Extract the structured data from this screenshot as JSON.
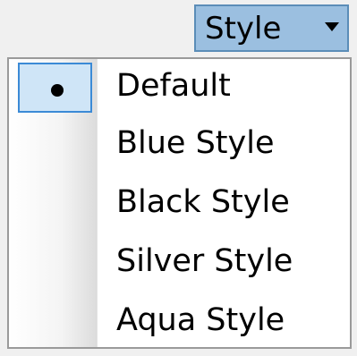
{
  "dropdown": {
    "label": "Style",
    "icon": "chevron-down-icon"
  },
  "menu": {
    "selected_index": 0,
    "selected_indicator_icon": "radio-dot-icon",
    "items": [
      {
        "label": "Default"
      },
      {
        "label": "Blue Style"
      },
      {
        "label": "Black Style"
      },
      {
        "label": "Silver Style"
      },
      {
        "label": "Aqua Style"
      }
    ]
  },
  "colors": {
    "dropdown_bg": "#9bbfe0",
    "dropdown_border": "#5b8db8",
    "selection_bg": "#cfe5f7",
    "selection_border": "#3b8ad6"
  }
}
